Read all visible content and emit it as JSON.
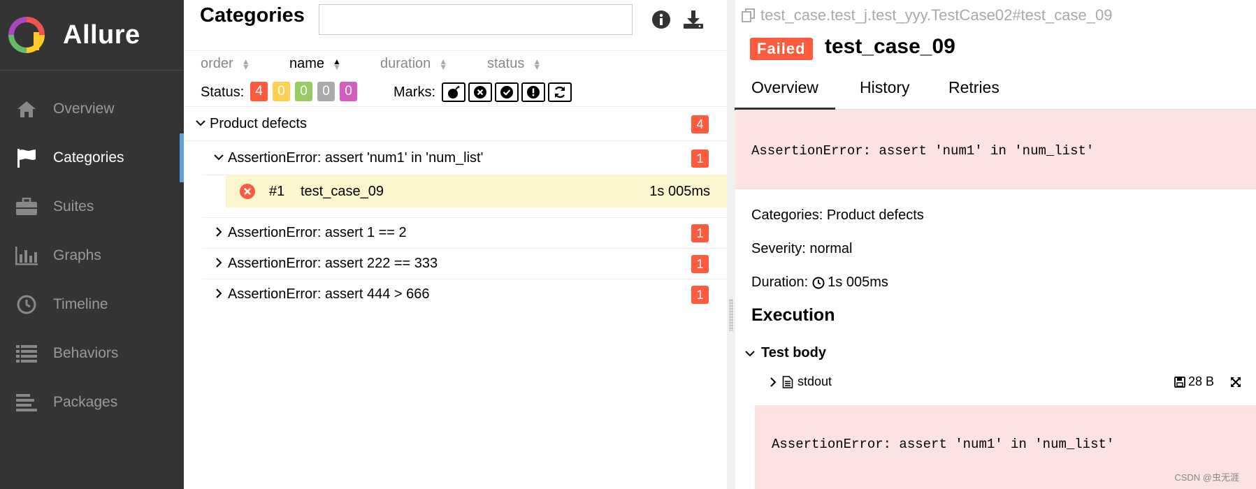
{
  "brand": {
    "name": "Allure"
  },
  "sidebar": {
    "items": [
      {
        "label": "Overview",
        "icon": "home-icon"
      },
      {
        "label": "Categories",
        "icon": "flag-icon",
        "active": true
      },
      {
        "label": "Suites",
        "icon": "briefcase-icon"
      },
      {
        "label": "Graphs",
        "icon": "bar-chart-icon"
      },
      {
        "label": "Timeline",
        "icon": "clock-icon"
      },
      {
        "label": "Behaviors",
        "icon": "list-icon"
      },
      {
        "label": "Packages",
        "icon": "align-left-icon"
      }
    ]
  },
  "middle": {
    "title": "Categories",
    "search_value": "",
    "sort": {
      "order": "order",
      "name": "name",
      "duration": "duration",
      "status": "status"
    },
    "status_label": "Status:",
    "status_counts": [
      {
        "value": "4",
        "color": "#fd5a3e"
      },
      {
        "value": "0",
        "color": "#ffd050"
      },
      {
        "value": "0",
        "color": "#97cc64"
      },
      {
        "value": "0",
        "color": "#aaaaaa"
      },
      {
        "value": "0",
        "color": "#d35ebe"
      }
    ],
    "marks_label": "Marks:",
    "tree": {
      "group": {
        "label": "Product defects",
        "count": "4"
      },
      "children": [
        {
          "label": "AssertionError: assert 'num1' in 'num_list'",
          "count": "1",
          "expanded": true
        },
        {
          "label": "AssertionError: assert 1 == 2",
          "count": "1"
        },
        {
          "label": "AssertionError: assert 222 == 333",
          "count": "1"
        },
        {
          "label": "AssertionError: assert 444 > 666",
          "count": "1"
        }
      ],
      "leaf": {
        "num": "#1",
        "name": "test_case_09",
        "duration": "1s 005ms"
      }
    }
  },
  "right": {
    "path": "test_case.test_j.test_yyy.TestCase02#test_case_09",
    "status": "Failed",
    "title": "test_case_09",
    "tabs": [
      "Overview",
      "History",
      "Retries"
    ],
    "error": "AssertionError: assert 'num1' in 'num_list'",
    "categories": "Categories: Product defects",
    "severity": "Severity: normal",
    "duration_label": "Duration:",
    "duration": "1s 005ms",
    "execution": "Execution",
    "test_body": "Test body",
    "stdout": "stdout",
    "size": "28 B",
    "error2": "AssertionError: assert 'num1' in 'num_list'"
  },
  "watermark": "CSDN @虫无涯"
}
